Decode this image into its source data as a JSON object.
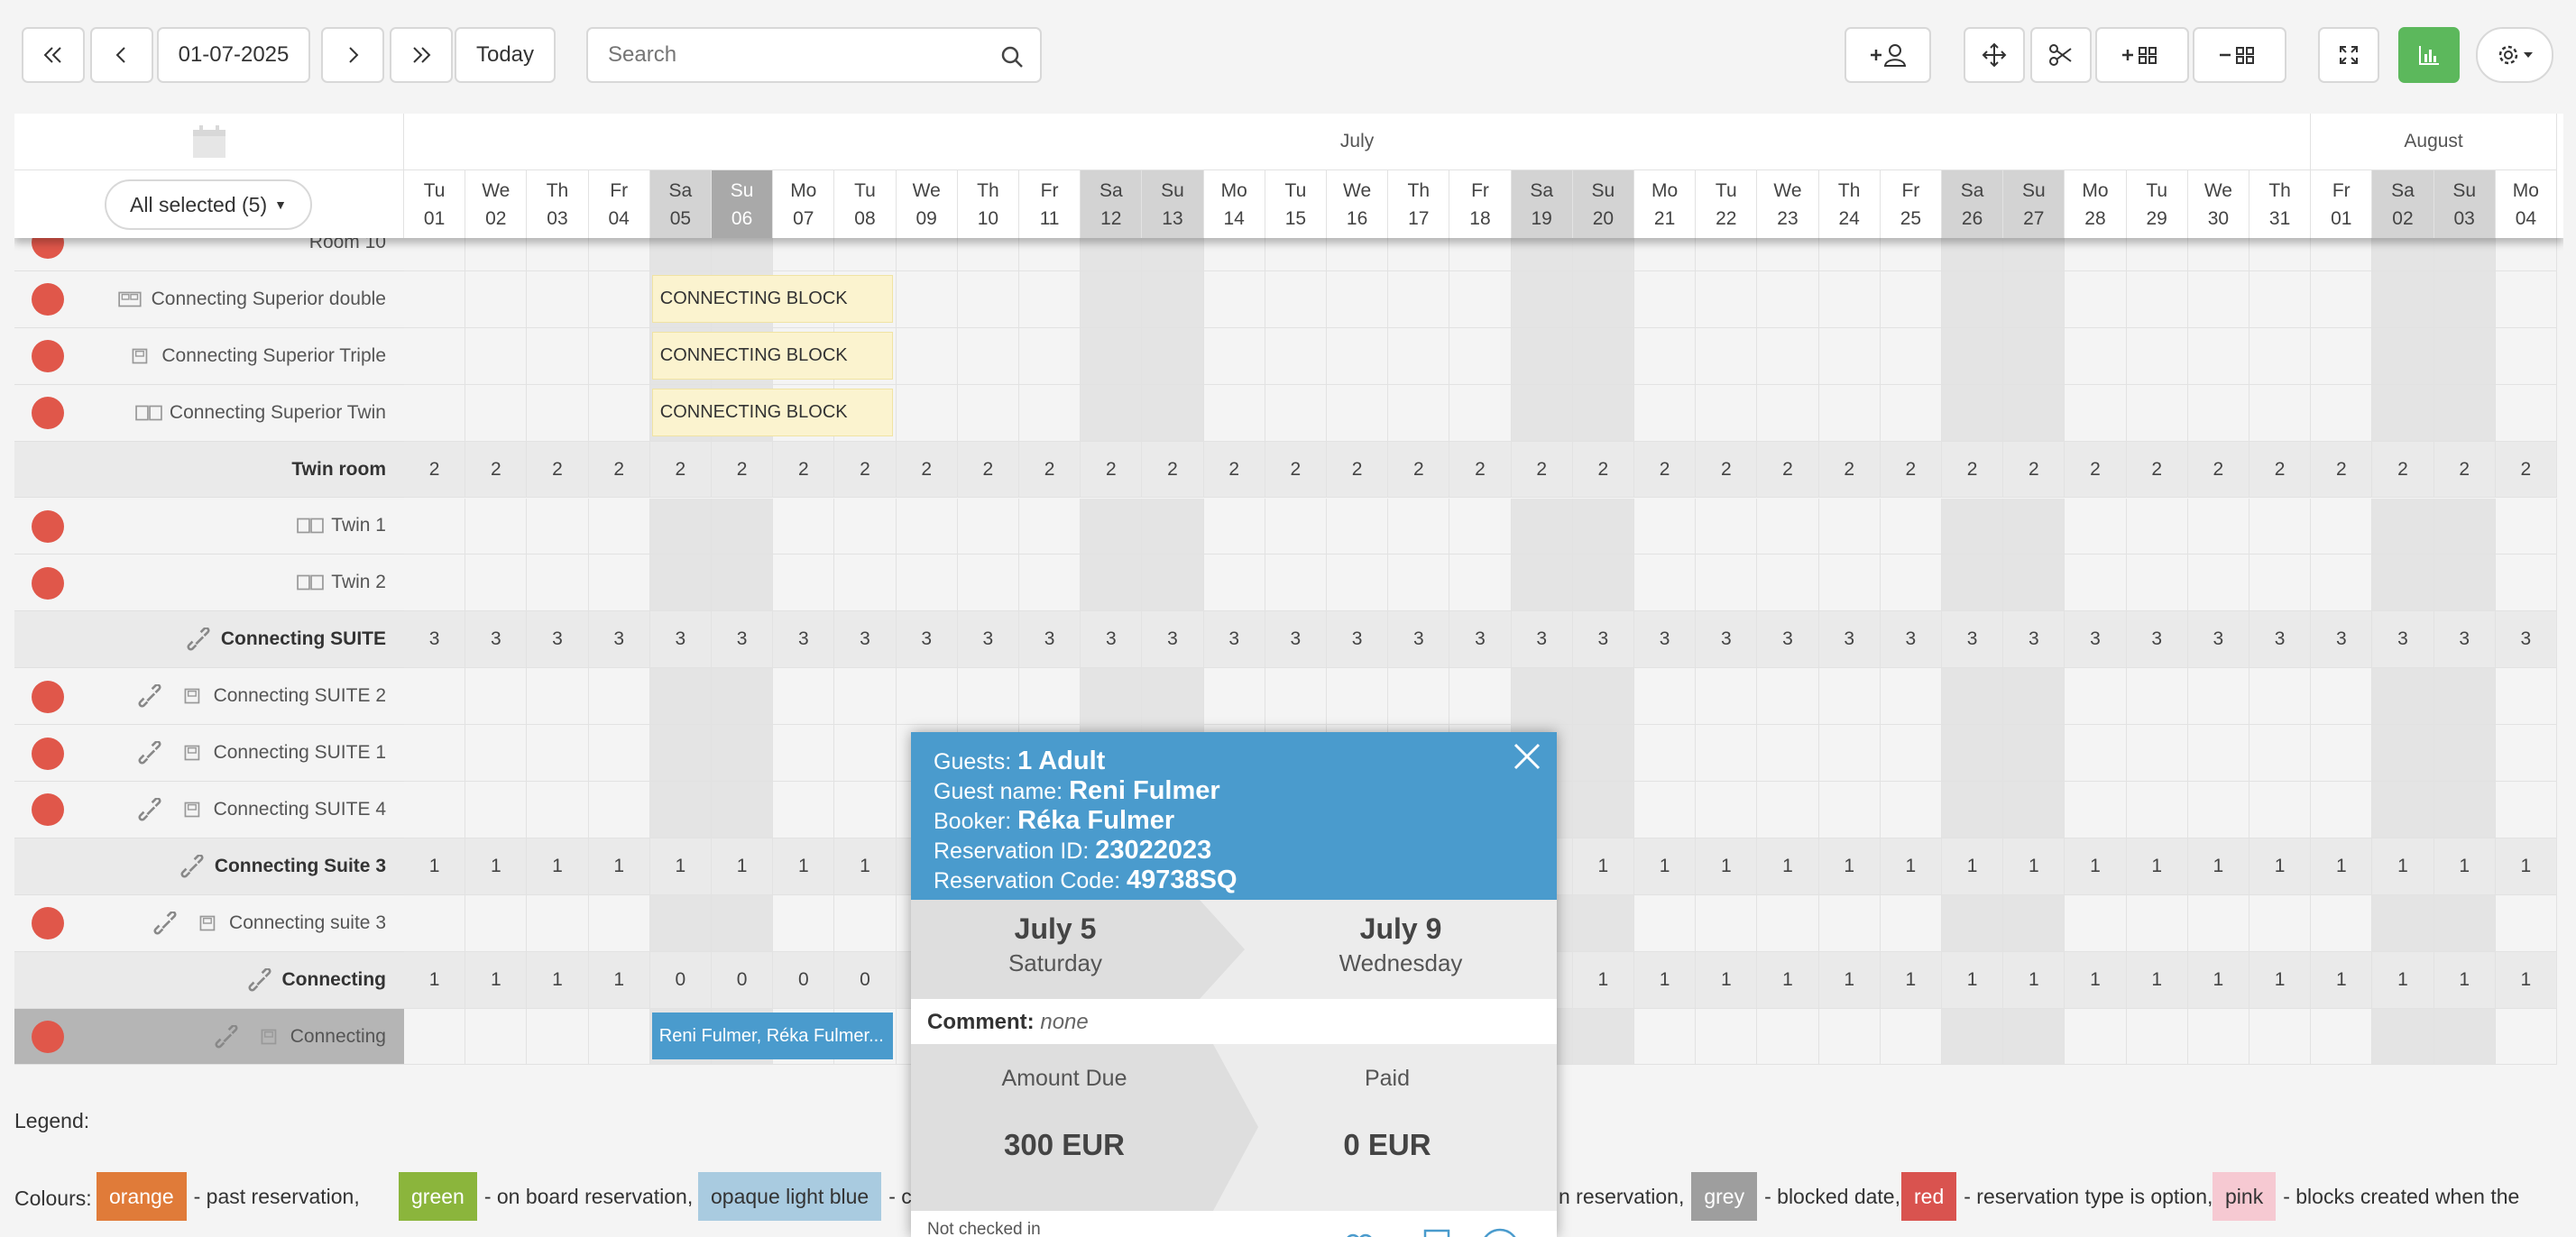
{
  "toolbar": {
    "date": "01-07-2025",
    "today": "Today",
    "search_placeholder": "Search"
  },
  "filter": {
    "label": "All selected (5)"
  },
  "months": [
    {
      "name": "July"
    },
    {
      "name": "August"
    }
  ],
  "days": [
    {
      "d": "Tu",
      "n": "01"
    },
    {
      "d": "We",
      "n": "02"
    },
    {
      "d": "Th",
      "n": "03"
    },
    {
      "d": "Fr",
      "n": "04"
    },
    {
      "d": "Sa",
      "n": "05"
    },
    {
      "d": "Su",
      "n": "06"
    },
    {
      "d": "Mo",
      "n": "07"
    },
    {
      "d": "Tu",
      "n": "08"
    },
    {
      "d": "We",
      "n": "09"
    },
    {
      "d": "Th",
      "n": "10"
    },
    {
      "d": "Fr",
      "n": "11"
    },
    {
      "d": "Sa",
      "n": "12"
    },
    {
      "d": "Su",
      "n": "13"
    },
    {
      "d": "Mo",
      "n": "14"
    },
    {
      "d": "Tu",
      "n": "15"
    },
    {
      "d": "We",
      "n": "16"
    },
    {
      "d": "Th",
      "n": "17"
    },
    {
      "d": "Fr",
      "n": "18"
    },
    {
      "d": "Sa",
      "n": "19"
    },
    {
      "d": "Su",
      "n": "20"
    },
    {
      "d": "Mo",
      "n": "21"
    },
    {
      "d": "Tu",
      "n": "22"
    },
    {
      "d": "We",
      "n": "23"
    },
    {
      "d": "Th",
      "n": "24"
    },
    {
      "d": "Fr",
      "n": "25"
    },
    {
      "d": "Sa",
      "n": "26"
    },
    {
      "d": "Su",
      "n": "27"
    },
    {
      "d": "Mo",
      "n": "28"
    },
    {
      "d": "Tu",
      "n": "29"
    },
    {
      "d": "We",
      "n": "30"
    },
    {
      "d": "Th",
      "n": "31"
    },
    {
      "d": "Fr",
      "n": "01"
    },
    {
      "d": "Sa",
      "n": "02"
    },
    {
      "d": "Su",
      "n": "03"
    },
    {
      "d": "Mo",
      "n": "04"
    }
  ],
  "rows": [
    {
      "label": "Room 10",
      "type": "room"
    },
    {
      "label": "Connecting Superior double",
      "type": "room",
      "icon": "double-bed-icon",
      "block": "CONNECTING BLOCK"
    },
    {
      "label": "Connecting Superior Triple",
      "type": "room",
      "icon": "single-bed-icon",
      "block": "CONNECTING BLOCK"
    },
    {
      "label": "Connecting Superior Twin",
      "type": "room",
      "icon": "twin-bed-icon",
      "block": "CONNECTING BLOCK"
    },
    {
      "label": "Twin room",
      "type": "sum",
      "value": "2"
    },
    {
      "label": "Twin 1",
      "type": "room",
      "icon": "twin-bed-icon"
    },
    {
      "label": "Twin 2",
      "type": "room",
      "icon": "twin-bed-icon"
    },
    {
      "label": "Connecting SUITE",
      "type": "sum",
      "value": "3",
      "link": true
    },
    {
      "label": "Connecting SUITE 2",
      "type": "room",
      "icon": "single-bed-icon",
      "link": true
    },
    {
      "label": "Connecting SUITE 1",
      "type": "room",
      "icon": "single-bed-icon",
      "link": true
    },
    {
      "label": "Connecting SUITE 4",
      "type": "room",
      "icon": "single-bed-icon",
      "link": true
    },
    {
      "label": "Connecting Suite 3",
      "type": "sum",
      "value": "1",
      "link": true
    },
    {
      "label": "Connecting suite 3",
      "type": "room",
      "icon": "single-bed-icon",
      "link": true
    },
    {
      "label": "Connecting",
      "type": "sum",
      "value": "1",
      "link": true,
      "zeros": [
        4,
        5,
        6,
        7
      ]
    },
    {
      "label": "Connecting",
      "type": "room",
      "icon": "single-bed-icon",
      "link": true,
      "selected": true,
      "reservation": "Reni Fulmer, Réka Fulmer..."
    }
  ],
  "popup": {
    "guests_label": "Guests:",
    "guests": "1 Adult",
    "guest_name_label": "Guest name:",
    "guest_name": "Reni Fulmer",
    "booker_label": "Booker:",
    "booker": "Réka Fulmer",
    "resid_label": "Reservation ID:",
    "resid": "23022023",
    "code_label": "Reservation Code:",
    "code": "49738SQ",
    "checkin_date": "July 5",
    "checkin_day": "Saturday",
    "checkout_date": "July 9",
    "checkout_day": "Wednesday",
    "comment_label": "Comment:",
    "comment": "none",
    "amount_due_label": "Amount Due",
    "amount_due": "300 EUR",
    "paid_label": "Paid",
    "paid": "0 EUR",
    "not_checked_in": "Not checked in"
  },
  "legend": {
    "title": "Legend:",
    "colours_label": "Colours:",
    "items": [
      {
        "swatch": "orange",
        "color": "#e07b39",
        "text": "- past reservation,"
      },
      {
        "swatch": "green",
        "color": "#8bb53c",
        "text": "- on board reservation,"
      },
      {
        "swatch": "opaque light blue",
        "color": "#a9cbe0",
        "text": "- chec"
      }
    ],
    "tail_items": [
      {
        "pre": "n reservation,",
        "swatch": "grey",
        "color": "#9e9e9e",
        "text": "- blocked date,"
      },
      {
        "swatch": "red",
        "color": "#d9534f",
        "text": "- reservation type is option,"
      },
      {
        "swatch": "pink",
        "color": "#f6c9d2",
        "text": "- blocks created when the"
      }
    ]
  }
}
